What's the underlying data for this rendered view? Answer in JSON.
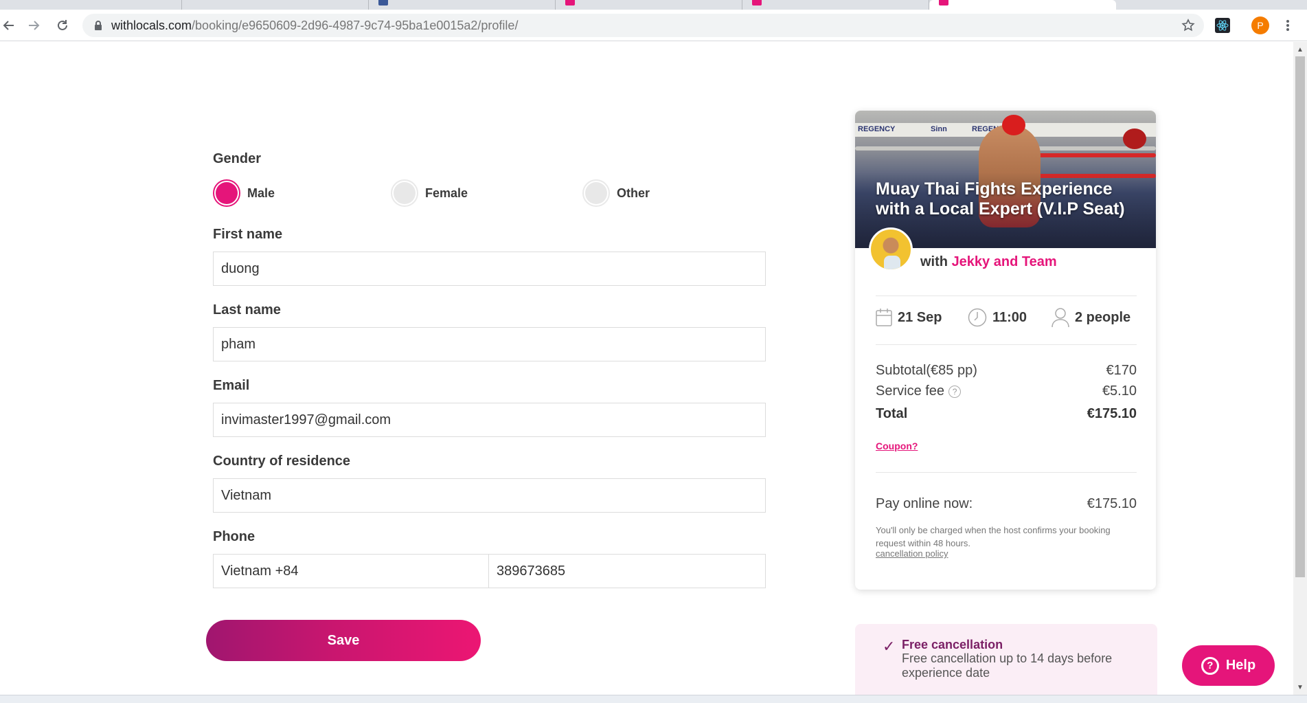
{
  "browser": {
    "url_host": "withlocals.com",
    "url_path": "/booking/e9650609-2d96-4987-9c74-95ba1e0015a2/profile/",
    "profile_initial": "P"
  },
  "form": {
    "gender_label": "Gender",
    "gender_options": [
      "Male",
      "Female",
      "Other"
    ],
    "gender_selected": "Male",
    "first_name_label": "First name",
    "first_name_value": "duong",
    "last_name_label": "Last name",
    "last_name_value": "pham",
    "email_label": "Email",
    "email_value": "invimaster1997@gmail.com",
    "country_label": "Country of residence",
    "country_value": "Vietnam",
    "phone_label": "Phone",
    "phone_country_value": "Vietnam +84",
    "phone_number_value": "389673685",
    "save_label": "Save"
  },
  "booking": {
    "title": "Muay Thai Fights Experience with a Local Expert (V.I.P Seat)",
    "host_prefix": "with",
    "host_name": "Jekky and Team",
    "date": "21 Sep",
    "time": "11:00",
    "people": "2 people",
    "subtotal_label": "Subtotal(€85 pp)",
    "subtotal_value": "€170",
    "service_fee_label": "Service fee",
    "service_fee_value": "€5.10",
    "total_label": "Total",
    "total_value": "€175.10",
    "coupon_label": "Coupon?",
    "pay_label": "Pay online now:",
    "pay_value": "€175.10",
    "note": "You'll only be charged when the host confirms your booking request within 48 hours.",
    "policy_link": "cancellation policy",
    "hero_banner_text": [
      "REGENCY",
      "Sinn",
      "REGENCY"
    ]
  },
  "cancellation": {
    "title": "Free cancellation",
    "text": "Free cancellation up to 14 days before experience date"
  },
  "help": {
    "label": "Help"
  },
  "colors": {
    "accent": "#e5157a",
    "save_gradient_start": "#a0166f",
    "cancel_bg": "#fbeef6"
  }
}
